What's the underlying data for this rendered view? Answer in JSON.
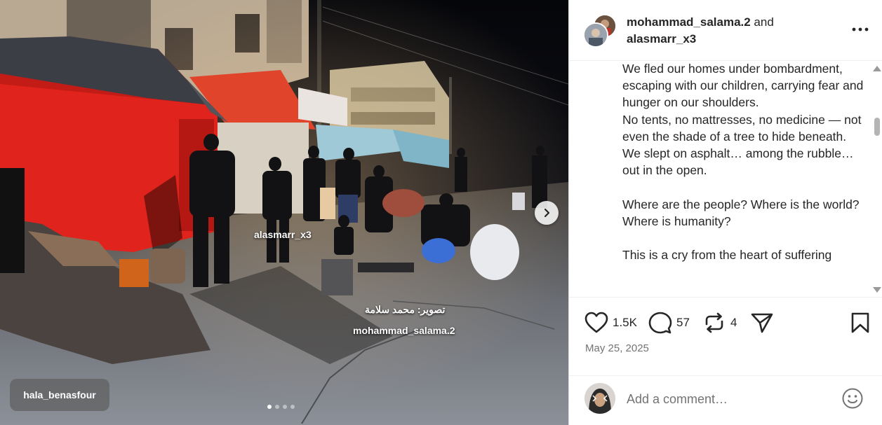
{
  "post": {
    "authors": [
      {
        "username": "mohammad_salama.2"
      },
      {
        "username": "alasmarr_x3"
      }
    ],
    "authors_joiner": " and ",
    "more_icon": "more-horizontal-icon"
  },
  "media": {
    "user_tag": "alasmarr_x3",
    "watermark_arabic": "تصوير: محمد سلامة",
    "watermark_handle": "mohammad_salama.2",
    "bottom_tag": "hala_benasfour",
    "carousel": {
      "count": 4,
      "active_index": 0
    },
    "next_icon": "chevron-right-icon"
  },
  "caption": {
    "text": "We fled our homes under bombardment, escaping with our children, carrying fear and hunger on our shoulders.\nNo tents, no mattresses, no medicine — not even the shade of a tree to hide beneath.\nWe slept on asphalt… among the rubble… out in the open.\n\nWhere are the people? Where is the world? Where is humanity?\n\nThis is a cry from the heart of suffering"
  },
  "actions": {
    "likes": "1.5K",
    "comments": "57",
    "reposts": "4",
    "like_icon": "heart-icon",
    "comment_icon": "comment-icon",
    "repost_icon": "repost-icon",
    "share_icon": "send-icon",
    "save_icon": "bookmark-icon"
  },
  "date": "May 25, 2025",
  "comment_box": {
    "placeholder": "Add a comment…",
    "emoji_icon": "emoji-smile-icon"
  },
  "colors": {
    "text": "#262626",
    "muted": "#737373",
    "tent_red": "#e0231c"
  }
}
